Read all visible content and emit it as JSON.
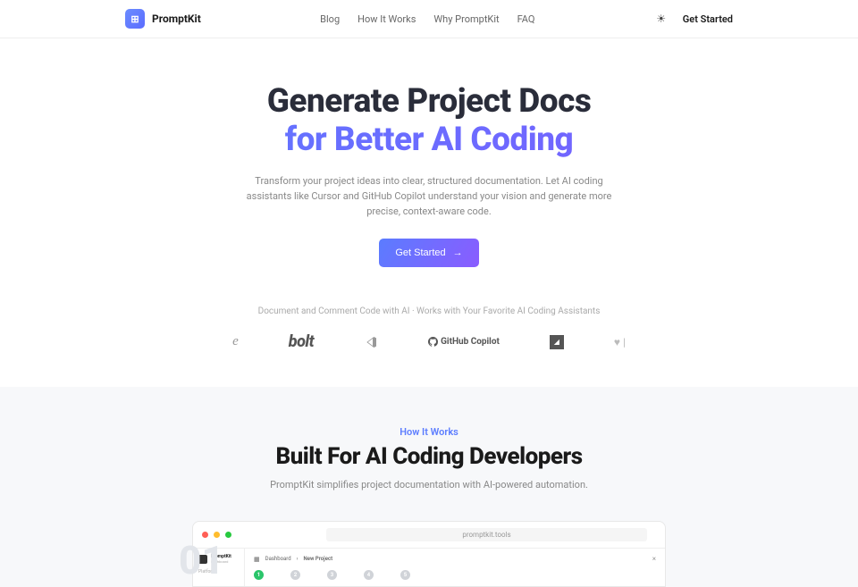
{
  "brand": "PromptKit",
  "nav": {
    "blog": "Blog",
    "how": "How It Works",
    "why": "Why PromptKit",
    "faq": "FAQ"
  },
  "header": {
    "getStarted": "Get Started"
  },
  "hero": {
    "title1": "Generate Project Docs",
    "title2": "for Better AI Coding",
    "desc": "Transform your project ideas into clear, structured documentation. Let AI coding assistants like Cursor and GitHub Copilot understand your vision and generate more precise, context-aware code.",
    "cta": "Get Started",
    "assistantsLabel": "Document and Comment Code with AI · Works with Your Favorite AI Coding Assistants"
  },
  "logos": {
    "bolt": "bolt",
    "copilot": "GitHub Copilot"
  },
  "section2": {
    "eyebrow": "How It Works",
    "title": "Built For AI Coding Developers",
    "desc": "PromptKit simplifies project documentation with AI-powered automation.",
    "stepNumber": "01"
  },
  "mock": {
    "url": "promptkit.tools",
    "brand": "PromptKit",
    "brandSub": "Dashboard",
    "sideLabel": "Platform",
    "crumbDash": "Dashboard",
    "crumbNew": "New Project",
    "steps": [
      "1",
      "2",
      "3",
      "4",
      "5"
    ]
  }
}
